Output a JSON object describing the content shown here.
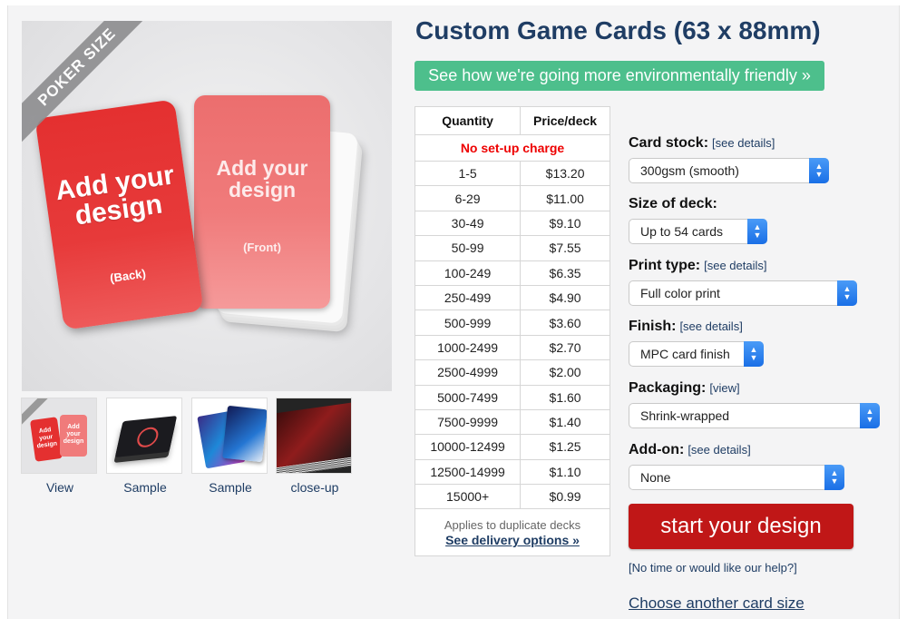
{
  "product": {
    "title": "Custom Game Cards (63 x 88mm)",
    "eco_banner": "See how we're going more environmentally friendly »"
  },
  "image": {
    "ribbon": "POKER SIZE",
    "back_text": "Add your design",
    "back_label": "(Back)",
    "front_text": "Add your design",
    "front_label": "(Front)"
  },
  "thumbnails": [
    {
      "label": "View",
      "mini_text": "Add your design"
    },
    {
      "label": "Sample"
    },
    {
      "label": "Sample"
    },
    {
      "label": "close-up"
    }
  ],
  "pricing": {
    "headers": [
      "Quantity",
      "Price/deck"
    ],
    "setup_note": "No set-up charge",
    "rows": [
      [
        "1-5",
        "$13.20"
      ],
      [
        "6-29",
        "$11.00"
      ],
      [
        "30-49",
        "$9.10"
      ],
      [
        "50-99",
        "$7.55"
      ],
      [
        "100-249",
        "$6.35"
      ],
      [
        "250-499",
        "$4.90"
      ],
      [
        "500-999",
        "$3.60"
      ],
      [
        "1000-2499",
        "$2.70"
      ],
      [
        "2500-4999",
        "$2.00"
      ],
      [
        "5000-7499",
        "$1.60"
      ],
      [
        "7500-9999",
        "$1.40"
      ],
      [
        "10000-12499",
        "$1.25"
      ],
      [
        "12500-14999",
        "$1.10"
      ],
      [
        "15000+",
        "$0.99"
      ]
    ],
    "footnote": "Applies to duplicate decks",
    "delivery_link": "See delivery options »"
  },
  "options": {
    "card_stock": {
      "label": "Card stock:",
      "details": "[see details]",
      "value": "300gsm (smooth)"
    },
    "deck_size": {
      "label": "Size of deck:",
      "value": "Up to 54 cards"
    },
    "print_type": {
      "label": "Print type:",
      "details": "[see details]",
      "value": "Full color print"
    },
    "finish": {
      "label": "Finish:",
      "details": "[see details]",
      "value": "MPC card finish"
    },
    "packaging": {
      "label": "Packaging:",
      "details": "[view]",
      "value": "Shrink-wrapped"
    },
    "addon": {
      "label": "Add-on:",
      "details": "[see details]",
      "value": "None"
    }
  },
  "actions": {
    "start": "start your design",
    "help": "[No time or would like our help?]",
    "other_size": "Choose another card size"
  },
  "colors": {
    "brand_blue": "#1f3d64",
    "eco_green": "#4dbf8c",
    "start_red": "#c01717",
    "setup_red": "#e00000",
    "select_arrow": "#1a6fe6"
  }
}
